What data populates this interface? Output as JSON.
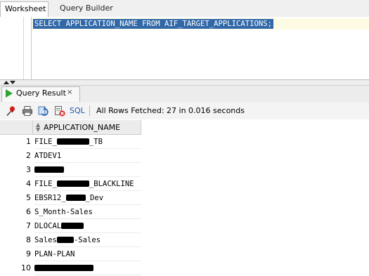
{
  "tabs": [
    {
      "label": "Worksheet"
    },
    {
      "label": "Query Builder"
    }
  ],
  "editor": {
    "sql": "SELECT APPLICATION_NAME FROM AIF_TARGET_APPLICATIONS;"
  },
  "result_tab": {
    "label": "Query Result",
    "close": "×"
  },
  "toolbar": {
    "icons": [
      "pin-icon",
      "print-icon",
      "refresh-icon",
      "clear-icon"
    ],
    "sql_label": "SQL",
    "separator": "|",
    "status": "All Rows Fetched: 27 in 0.016 seconds"
  },
  "grid": {
    "column": "APPLICATION_NAME",
    "rows": [
      {
        "n": "1",
        "pre": "FILE_",
        "redact": true,
        "post": "_TB"
      },
      {
        "n": "2",
        "pre": "ATDEV1",
        "redact": false,
        "post": ""
      },
      {
        "n": "3",
        "pre": "",
        "redact": true,
        "post": ""
      },
      {
        "n": "4",
        "pre": "FILE_",
        "redact": true,
        "post": "_BLACKLINE"
      },
      {
        "n": "5",
        "pre": "EBSR12_",
        "redact": true,
        "post": "_Dev"
      },
      {
        "n": "6",
        "pre": "S_Month-Sales",
        "redact": false,
        "post": ""
      },
      {
        "n": "7",
        "pre": "DLOCAL",
        "redact": true,
        "post": ""
      },
      {
        "n": "8",
        "pre": "Sales",
        "redact": true,
        "post": "-Sales"
      },
      {
        "n": "9",
        "pre": "PLAN-PLAN",
        "redact": false,
        "post": ""
      },
      {
        "n": "10",
        "pre": "",
        "redact": true,
        "post": ""
      }
    ]
  },
  "colors": {
    "selection": "#3168a8",
    "run_green": "#2fa32f",
    "link_blue": "#2457a8"
  }
}
